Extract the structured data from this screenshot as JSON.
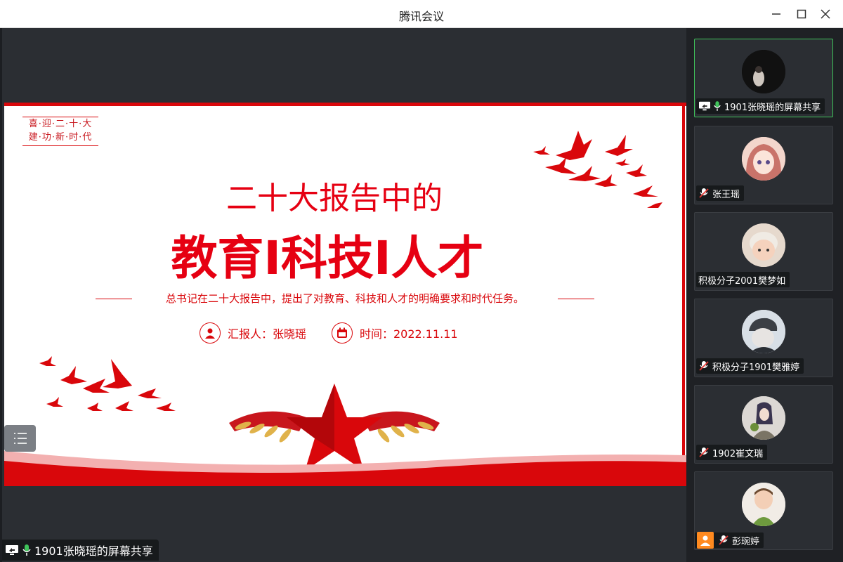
{
  "window": {
    "title": "腾讯会议"
  },
  "slide": {
    "seal_line1": "喜·迎·二·十·大",
    "seal_line2": "建·功·新·时·代",
    "title_line1": "二十大报告中的",
    "title_line2": "教育I科技I人才",
    "subtitle": "总书记在二十大报告中，提出了对教育、科技和人才的明确要求和时代任务。",
    "reporter": "汇报人：张晓瑶",
    "time": "时间：2022.11.11"
  },
  "share_label": "1901张晓瑶的屏幕共享",
  "participants": [
    {
      "name": "1901张晓瑶的屏幕共享",
      "mic": "on",
      "sharing": true,
      "active": true
    },
    {
      "name": "张王瑶",
      "mic": "muted"
    },
    {
      "name": "积极分子2001樊梦如",
      "mic": "none"
    },
    {
      "name": "积极分子1901樊雅婷",
      "mic": "muted"
    },
    {
      "name": "1902崔文瑞",
      "mic": "muted"
    },
    {
      "name": "彭琬婷",
      "mic": "muted",
      "no_video_icon": true
    }
  ],
  "colors": {
    "accent_red": "#e60012",
    "active_border": "#3fc35a",
    "mic_green": "#3fc35a"
  }
}
